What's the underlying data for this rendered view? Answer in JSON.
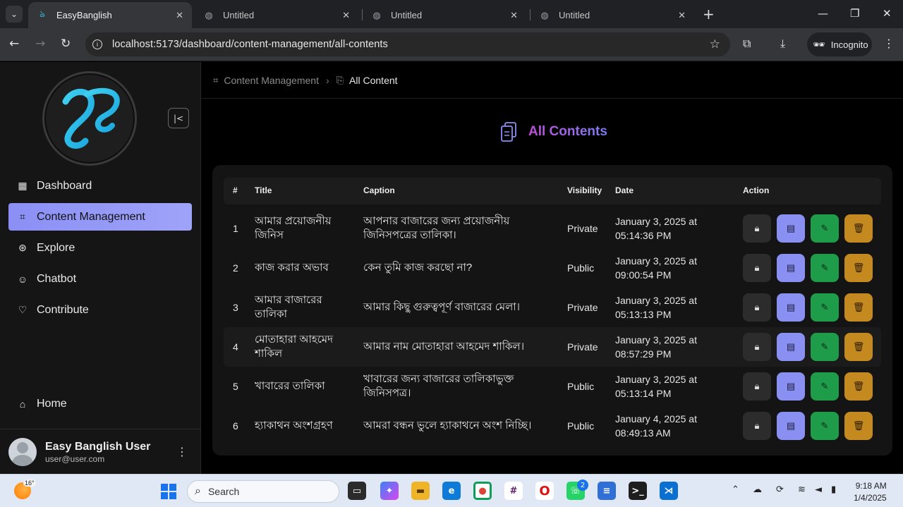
{
  "browser": {
    "tabs": [
      {
        "title": "EasyBanglish",
        "active": true
      },
      {
        "title": "Untitled",
        "active": false
      },
      {
        "title": "Untitled",
        "active": false
      },
      {
        "title": "Untitled",
        "active": false
      }
    ],
    "url": "localhost:5173/dashboard/content-management/all-contents",
    "incognito_label": "Incognito"
  },
  "sidebar": {
    "items": [
      {
        "label": "Dashboard",
        "icon": "grid-icon"
      },
      {
        "label": "Content Management",
        "icon": "frame-icon",
        "active": true
      },
      {
        "label": "Explore",
        "icon": "compass-icon"
      },
      {
        "label": "Chatbot",
        "icon": "robot-icon"
      },
      {
        "label": "Contribute",
        "icon": "hand-heart-icon"
      }
    ],
    "home_label": "Home",
    "user": {
      "name": "Easy Banglish User",
      "email": "user@user.com"
    }
  },
  "breadcrumb": {
    "parent": "Content Management",
    "current": "All Content"
  },
  "page": {
    "heading": "All Contents"
  },
  "table": {
    "headers": [
      "#",
      "Title",
      "Caption",
      "Visibility",
      "Date",
      "Action"
    ],
    "rows": [
      {
        "num": "1",
        "title": "আমার প্রয়োজনীয় জিনিস",
        "caption": "আপনার বাজারের জন্য প্রয়োজনীয় জিনিসপত্রের তালিকা।",
        "visibility": "Private",
        "date": "January 3, 2025 at 05:14:36 PM"
      },
      {
        "num": "2",
        "title": "কাজ করার অভাব",
        "caption": "কেন তুমি কাজ করছো না?",
        "visibility": "Public",
        "date": "January 3, 2025 at 09:00:54 PM"
      },
      {
        "num": "3",
        "title": "আমার বাজারের তালিকা",
        "caption": "আমার কিছু গুরুত্বপূর্ণ বাজারের মেলা।",
        "visibility": "Private",
        "date": "January 3, 2025 at 05:13:13 PM"
      },
      {
        "num": "4",
        "title": "মোতাহারা আহমেদ শাকিল",
        "caption": "আমার নাম মোতাহারা আহমেদ শাকিল।",
        "visibility": "Private",
        "date": "January 3, 2025 at 08:57:29 PM"
      },
      {
        "num": "5",
        "title": "খাবারের তালিকা",
        "caption": "খাবারের জন্য বাজারের তালিকাভুক্ত জিনিসপত্র।",
        "visibility": "Public",
        "date": "January 3, 2025 at 05:13:14 PM"
      },
      {
        "num": "6",
        "title": "হ্যাকাথন অংশগ্রহণ",
        "caption": "আমরা বন্ধন ভুলে হ্যাকাথনে অংশ নিচ্ছি।",
        "visibility": "Public",
        "date": "January 4, 2025 at 08:49:13 AM"
      }
    ]
  },
  "taskbar": {
    "weather": "16°",
    "search_placeholder": "Search",
    "whatsapp_badge": "2",
    "time": "9:18 AM",
    "date": "1/4/2025"
  },
  "colors": {
    "accent": "#8b8ff5",
    "pdf": "#8a8ff2",
    "edit": "#1f9c4a",
    "delete": "#c58a1f"
  }
}
